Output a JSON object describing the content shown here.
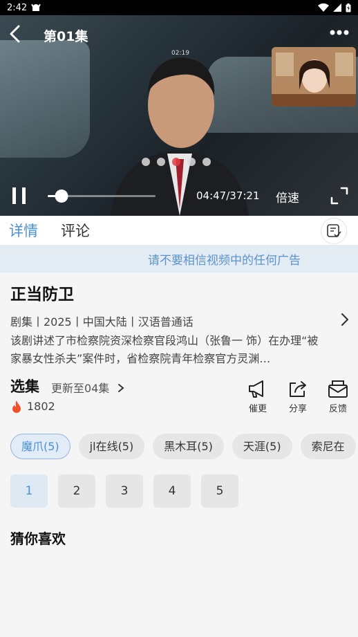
{
  "status_bar": {
    "time": "2:42"
  },
  "video": {
    "episode_title": "第01集",
    "inner_call_time": "02:19",
    "current_time": "04:47",
    "total_time": "37:21",
    "time_display": "04:47/37:21",
    "progress": 0.128,
    "speed_label": "倍速"
  },
  "tabs": [
    {
      "label": "详情",
      "active": true
    },
    {
      "label": "评论",
      "active": false
    }
  ],
  "notice": "请不要相信视频中的任何广告",
  "show": {
    "title": "正当防卫",
    "meta": "剧集丨2025丨中国大陆丨汉语普通话",
    "description": "该剧讲述了市检察院资深检察官段鸿山（张鲁一 饰）在办理“被家暴女性杀夫”案件时，省检察院青年检察官方灵渊…"
  },
  "episodes": {
    "label": "选集",
    "update_text": "更新至04集",
    "heat": "1802"
  },
  "actions": [
    {
      "label": "催更",
      "icon": "megaphone-icon"
    },
    {
      "label": "分享",
      "icon": "share-icon"
    },
    {
      "label": "反馈",
      "icon": "mail-icon"
    }
  ],
  "sources": [
    {
      "label": "魔爪(5)",
      "selected": true
    },
    {
      "label": "jl在线(5)",
      "selected": false
    },
    {
      "label": "黑木耳(5)",
      "selected": false
    },
    {
      "label": "天涯(5)",
      "selected": false
    },
    {
      "label": "索尼在",
      "selected": false
    }
  ],
  "episode_numbers": [
    {
      "label": "1",
      "selected": true
    },
    {
      "label": "2",
      "selected": false
    },
    {
      "label": "3",
      "selected": false
    },
    {
      "label": "4",
      "selected": false
    },
    {
      "label": "5",
      "selected": false
    }
  ],
  "recommend_title": "猜你喜欢",
  "colors": {
    "accent": "#4a90d9",
    "notice_bg": "#e3ebf3",
    "heat": "#f0502c"
  }
}
